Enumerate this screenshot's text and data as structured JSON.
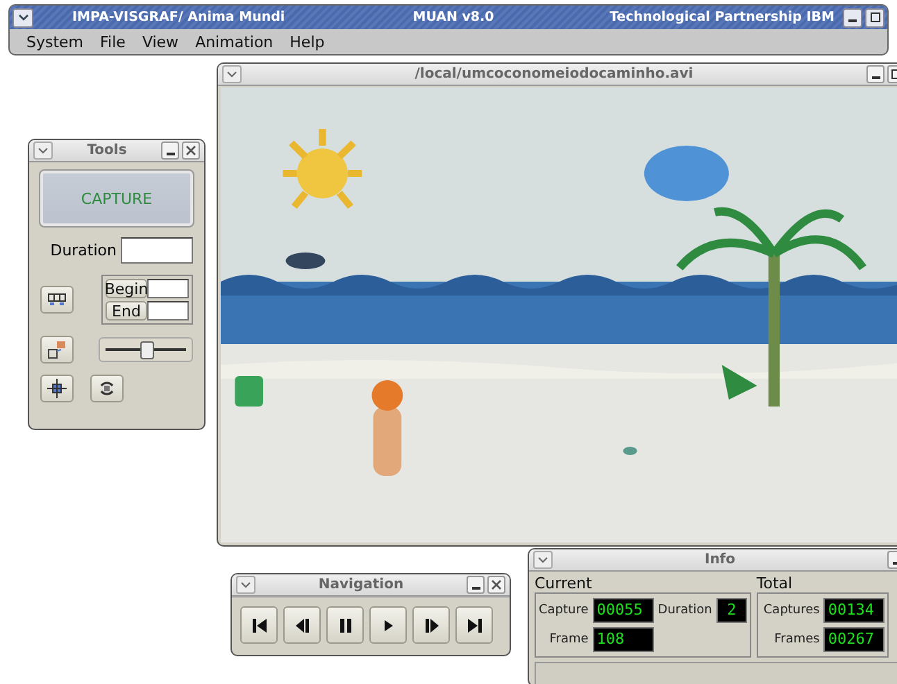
{
  "app": {
    "title_left": "IMPA-VISGRAF/ Anima Mundi",
    "title_center": "MUAN v8.0",
    "title_right": "Technological Partnership IBM",
    "controls": [
      {
        "kind": "minimize"
      },
      {
        "kind": "maximize"
      }
    ]
  },
  "menu": [
    "System",
    "File",
    "View",
    "Animation",
    "Help"
  ],
  "video": {
    "title": "/local/umcoconomeiodocaminho.avi",
    "controls": [
      {
        "kind": "minimize"
      },
      {
        "kind": "maximize"
      }
    ],
    "kind": "picture"
  },
  "tools": {
    "title": "Tools",
    "controls": [
      {
        "kind": "minimize"
      },
      {
        "kind": "close"
      }
    ],
    "capture": "CAPTURE",
    "duration_label": "Duration",
    "begin": "Begin",
    "end": "End",
    "slider": {
      "level": 0.5
    },
    "icon_buttons": [
      {
        "kind": "grid"
      },
      {
        "kind": "copy"
      },
      {
        "kind": "move"
      },
      {
        "kind": "cycle"
      }
    ]
  },
  "navigation": {
    "title": "Navigation",
    "controls": [
      {
        "kind": "minimize"
      },
      {
        "kind": "close"
      }
    ],
    "buttons": [
      {
        "kind": "first"
      },
      {
        "kind": "prev"
      },
      {
        "kind": "pause"
      },
      {
        "kind": "play"
      },
      {
        "kind": "next"
      },
      {
        "kind": "last"
      }
    ]
  },
  "info": {
    "title": "Info",
    "controls": [
      {
        "kind": "minimize"
      }
    ],
    "current_label": "Current",
    "capture_label": "Capture",
    "capture": "00055",
    "duration_label": "Duration",
    "duration": "2",
    "frame_label": "Frame",
    "frame": "108",
    "total_label": "Total",
    "captures_label": "Captures",
    "captures": "00134",
    "frames_label": "Frames",
    "frames": "00267"
  }
}
